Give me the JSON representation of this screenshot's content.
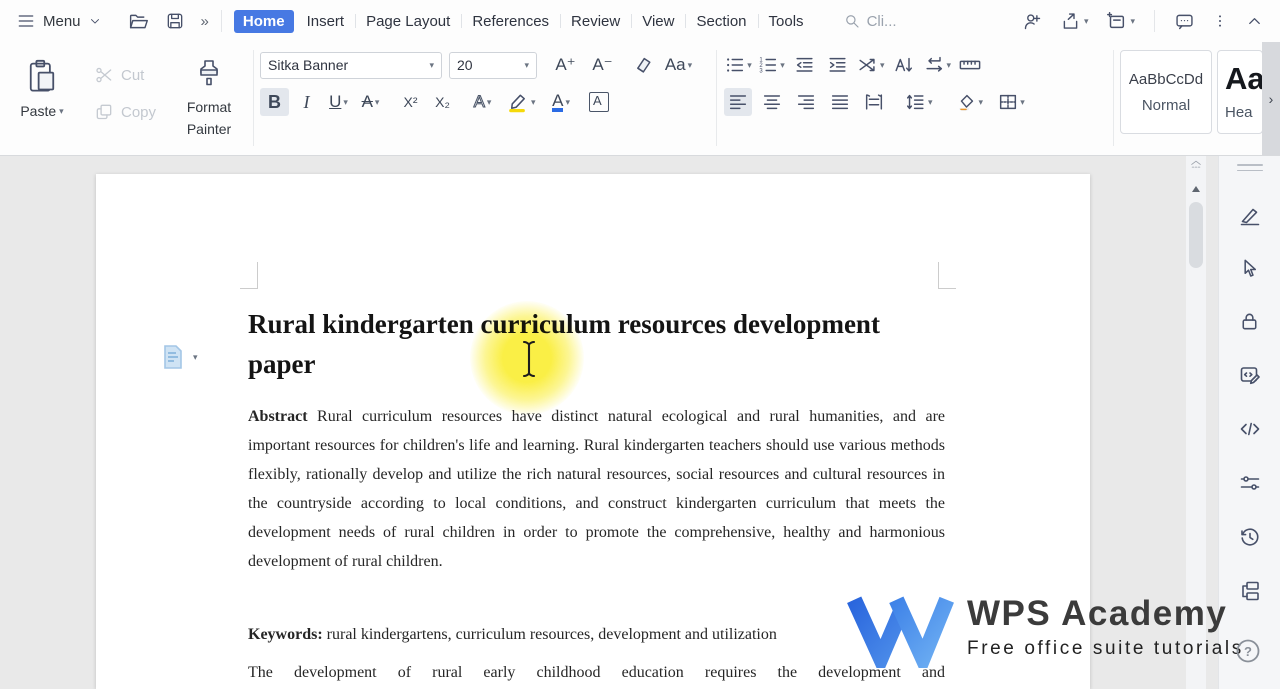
{
  "titlebar": {
    "menu_label": "Menu",
    "tabs": [
      {
        "label": "Home",
        "active": true
      },
      {
        "label": "Insert",
        "active": false
      },
      {
        "label": "Page Layout",
        "active": false
      },
      {
        "label": "References",
        "active": false
      },
      {
        "label": "Review",
        "active": false
      },
      {
        "label": "View",
        "active": false
      },
      {
        "label": "Section",
        "active": false
      },
      {
        "label": "Tools",
        "active": false
      }
    ],
    "search_placeholder": "Cli..."
  },
  "ribbon": {
    "clipboard": {
      "paste": "Paste",
      "cut": "Cut",
      "copy": "Copy",
      "format_painter_line1": "Format",
      "format_painter_line2": "Painter"
    },
    "font": {
      "name": "Sitka Banner",
      "size": "20",
      "grow": "A⁺",
      "shrink": "A⁻",
      "case_glyph": "Aa",
      "bold": "B",
      "italic": "I",
      "underline": "U",
      "strike": "A",
      "superscript": "X²",
      "subscript": "X₂",
      "effects": "A",
      "color_glyph": "A",
      "border_glyph": "A"
    },
    "styles": {
      "items": [
        {
          "preview": "AaBbCcDd",
          "name": "Normal"
        },
        {
          "preview": "Aa",
          "name": "Hea"
        }
      ]
    }
  },
  "document": {
    "title": "Rural kindergarten curriculum resources development paper",
    "abstract_label": "Abstract",
    "abstract_text": " Rural curriculum resources have distinct natural ecological and rural humanities, and are important resources for children's life and learning. Rural kindergarten teachers should use various methods flexibly, rationally develop and utilize the rich natural resources, social resources and cultural resources in the countryside according to local conditions, and construct kindergarten curriculum that meets the development needs of rural children in order to promote the comprehensive, healthy and harmonious development of rural children.",
    "keywords_label": "Keywords:",
    "keywords_text": " rural kindergartens, curriculum resources, development and utilization",
    "next_paragraph": "The development of rural early childhood education requires the development and"
  },
  "watermark": {
    "brand": "WPS Academy",
    "tagline": "Free office suite tutorials"
  },
  "icons": {
    "caret": "▾",
    "double_chevron": "»",
    "chevron_right": "›",
    "question": "?",
    "num1": "1",
    "num2": "2",
    "num3": "3"
  },
  "colors": {
    "accent_blue": "#4779e3",
    "highlight_yellow": "#faee3c",
    "font_color_swatch": "#2b6be4",
    "highlighter_swatch": "#f5d90a",
    "watermark_blue_dark": "#2a66dd",
    "watermark_blue_light": "#6fb0f3"
  }
}
